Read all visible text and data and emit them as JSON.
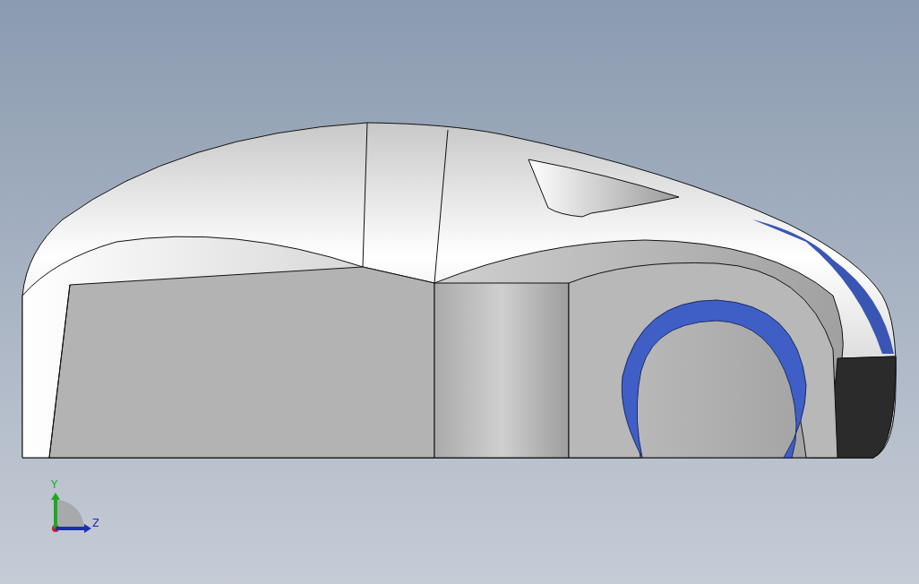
{
  "viewport": {
    "triad": {
      "axes": [
        {
          "label": "Y",
          "kind": "vertical",
          "color": "#1fa81f"
        },
        {
          "label": "Z",
          "kind": "horizontal",
          "color": "#1a2fb0"
        }
      ]
    }
  }
}
